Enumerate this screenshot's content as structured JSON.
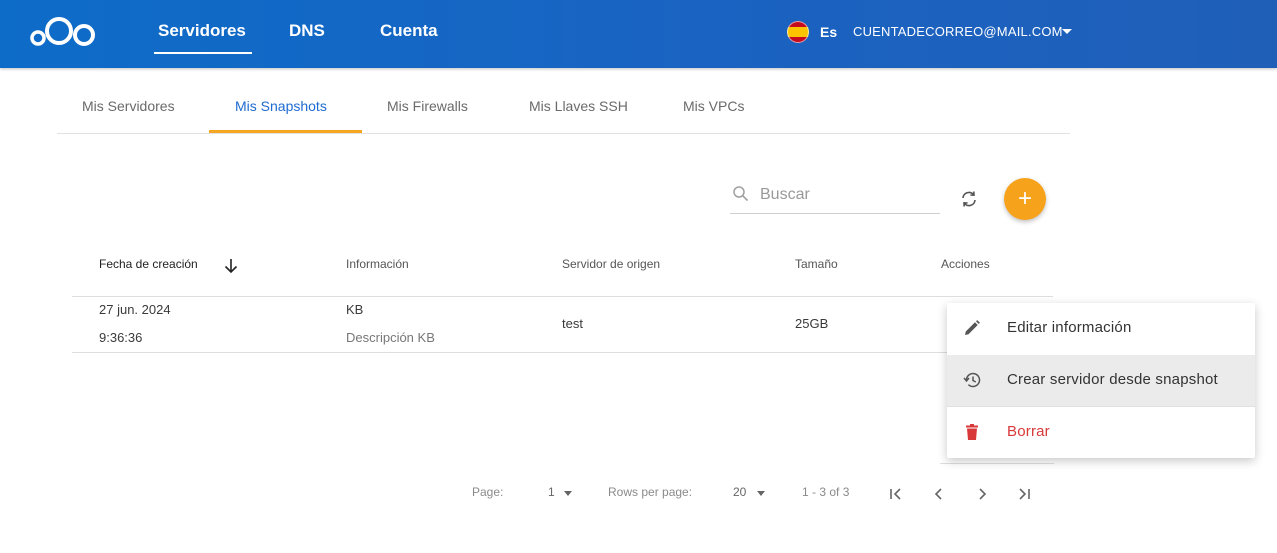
{
  "header": {
    "nav": [
      {
        "label": "Servidores",
        "active": true
      },
      {
        "label": "DNS",
        "active": false
      },
      {
        "label": "Cuenta",
        "active": false
      }
    ],
    "language": {
      "code": "Es",
      "flag_icon": "spain-flag-icon"
    },
    "account_email": "CUENTADECORREO@MAIL.COM"
  },
  "subtabs": [
    {
      "label": "Mis Servidores",
      "active": false
    },
    {
      "label": "Mis Snapshots",
      "active": true
    },
    {
      "label": "Mis Firewalls",
      "active": false
    },
    {
      "label": "Mis Llaves SSH",
      "active": false
    },
    {
      "label": "Mis VPCs",
      "active": false
    }
  ],
  "toolbar": {
    "search_placeholder": "Buscar",
    "add_label": "+"
  },
  "table": {
    "columns": [
      "Fecha de creación",
      "Información",
      "Servidor de origen",
      "Tamaño",
      "Acciones"
    ],
    "rows": [
      {
        "date": "27 jun. 2024",
        "time": "9:36:36",
        "info_title": "KB",
        "info_desc": "Descripción KB",
        "origin": "test",
        "size": "25GB"
      }
    ]
  },
  "pagination": {
    "page_label": "Page:",
    "page_value": "1",
    "rows_label": "Rows per page:",
    "rows_value": "20",
    "range": "1 - 3 of 3"
  },
  "context_menu": {
    "items": [
      {
        "label": "Editar información",
        "icon": "pencil-icon"
      },
      {
        "label": "Crear servidor desde snapshot",
        "icon": "restore-history-icon"
      },
      {
        "label": "Borrar",
        "icon": "trash-icon"
      }
    ]
  },
  "colors": {
    "header_blue": "#1a63c2",
    "accent_orange": "#f7a21b",
    "active_tab_blue": "#1e6bd1",
    "danger_red": "#d8383a"
  }
}
